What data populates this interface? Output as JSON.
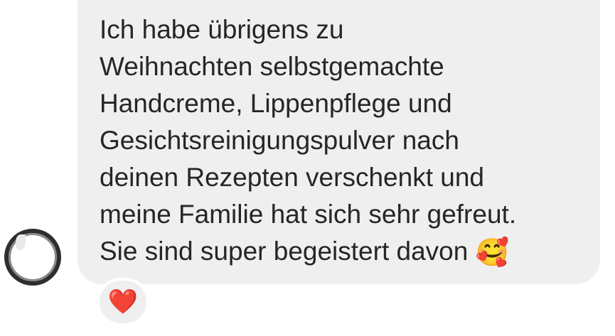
{
  "message": {
    "lines": [
      "Ich habe übrigens zu",
      "Weihnachten selbstgemachte",
      "Handcreme, Lippenpflege und",
      "Gesichtsreinigungspulver nach",
      "deinen Rezepten verschenkt und",
      "meine Familie hat sich sehr gefreut.",
      "Sie sind super begeistert davon "
    ],
    "emoji": "🥰"
  },
  "reaction": {
    "emoji": "❤️",
    "icon": "heart-icon",
    "color": "#e0303a"
  },
  "colors": {
    "bubble": "#efefef",
    "text": "#262626",
    "background": "#ffffff"
  }
}
